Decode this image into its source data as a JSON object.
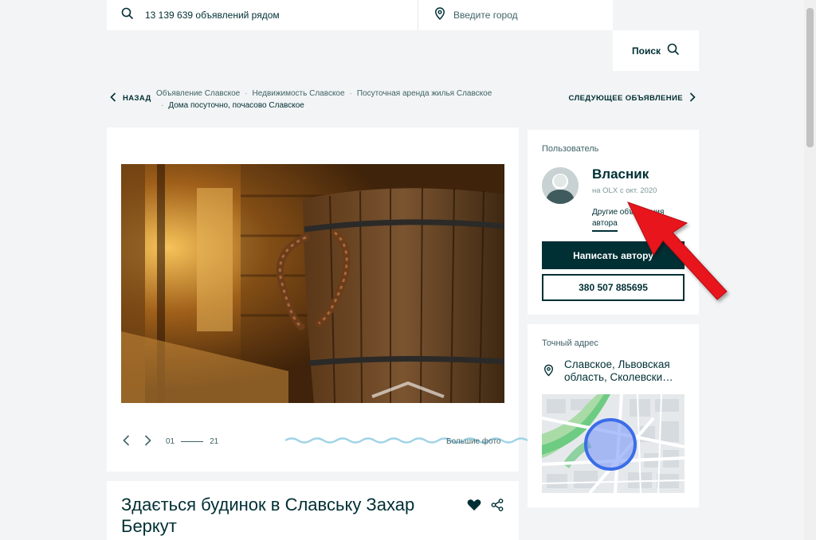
{
  "search": {
    "query_text": "13 139 639 объявлений рядом",
    "city_placeholder": "Введите город",
    "button_label": "Поиск"
  },
  "breadcrumb": {
    "back_label": "НАЗАД",
    "items": [
      "Объявление Славское",
      "Недвижимость Славское",
      "Посуточная аренда жилья Славское",
      "Дома посуточно, почасово Славское"
    ],
    "next_label": "СЛЕДУЮЩЕЕ ОБЪЯВЛЕНИЕ"
  },
  "gallery": {
    "current": "01",
    "total": "21",
    "big_photo_label": "Большие фото"
  },
  "listing": {
    "title": "Здається будинок в Славську Захар Беркут"
  },
  "user": {
    "heading": "Пользователь",
    "name": "Власник",
    "since": "на OLX с окт. 2020",
    "other_ads": "Другие объявления автора",
    "write_button": "Написать автору",
    "phone": "380 507 885695"
  },
  "address": {
    "heading": "Точный адрес",
    "text": "Славское, Львовская область, Сколевски…"
  },
  "colors": {
    "brand_dark": "#002f34",
    "background": "#f2f4f5",
    "arrow": "#e8141c"
  }
}
